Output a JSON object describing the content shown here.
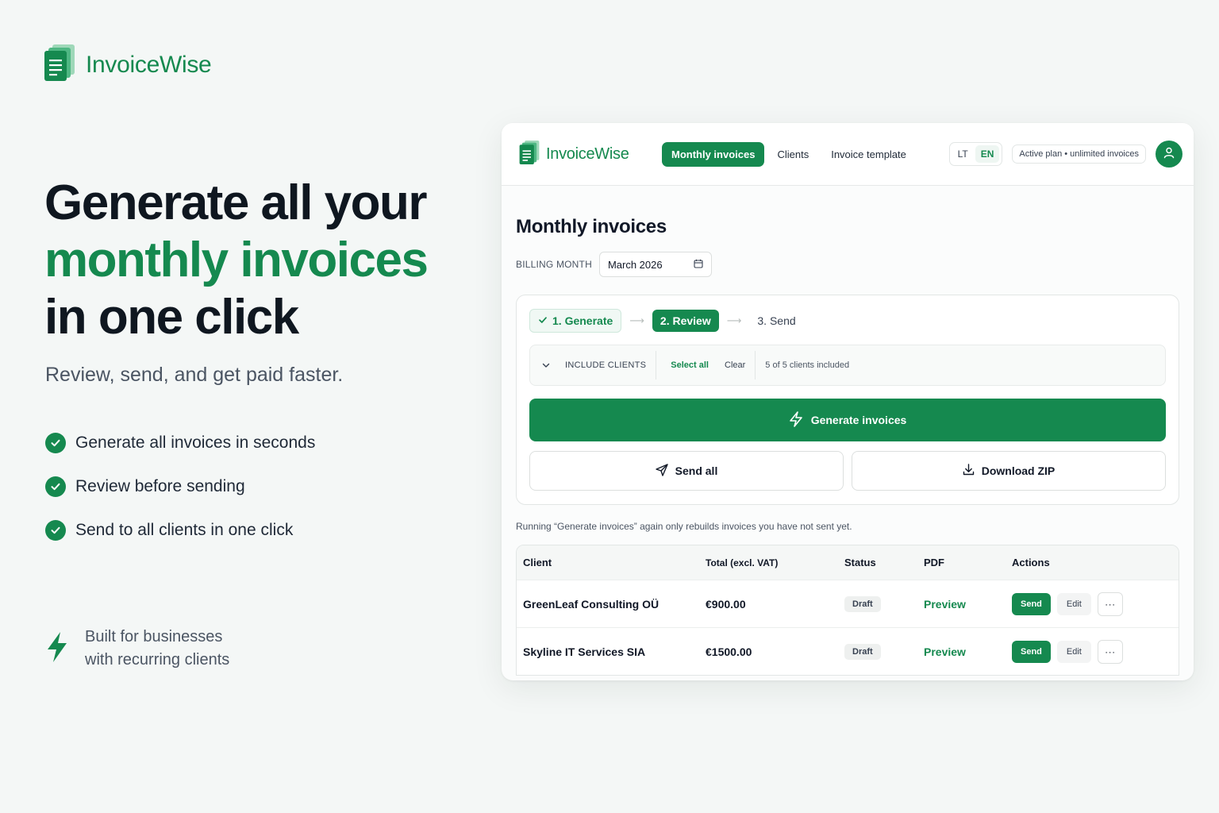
{
  "brand": {
    "name": "InvoiceWise"
  },
  "hero": {
    "title_line1": "Generate all your",
    "title_line2": "monthly invoices",
    "title_line3": "in one click",
    "subtitle": "Review, send, and get paid faster.",
    "features": [
      "Generate all invoices in seconds",
      "Review before sending",
      "Send to all clients in one click"
    ],
    "built_line1": "Built for businesses",
    "built_line2": "with recurring clients"
  },
  "app": {
    "brand": "InvoiceWise",
    "nav": [
      "Monthly invoices",
      "Clients",
      "Invoice template"
    ],
    "lang": [
      "LT",
      "EN"
    ],
    "plan": "Active plan • unlimited invoices",
    "page_title": "Monthly invoices",
    "billing_label": "BILLING MONTH",
    "billing_month": "March 2026",
    "steps": [
      "1. Generate",
      "2. Review",
      "3. Send"
    ],
    "include_label": "INCLUDE CLIENTS",
    "select_all": "Select all",
    "clear": "Clear",
    "included_text": "5 of 5 clients included",
    "generate_label": "Generate invoices",
    "send_all_label": "Send all",
    "download_label": "Download ZIP",
    "note": "Running “Generate invoices” again only rebuilds invoices you have not sent yet.",
    "table": {
      "headers": [
        "Client",
        "Total (excl. VAT)",
        "Status",
        "PDF",
        "Actions"
      ],
      "rows": [
        {
          "client": "GreenLeaf Consulting OÜ",
          "total": "€900.00",
          "status": "Draft",
          "pdf": "Preview",
          "send": "Send",
          "edit": "Edit",
          "more": "···"
        },
        {
          "client": "Skyline IT Services SIA",
          "total": "€1500.00",
          "status": "Draft",
          "pdf": "Preview",
          "send": "Send",
          "edit": "Edit",
          "more": "···"
        }
      ]
    }
  },
  "colors": {
    "accent": "#15894f",
    "background": "#f4f7f6",
    "text": "#0f1720"
  },
  "icons": [
    "document-stack-icon",
    "check-circle-icon",
    "lightning-bolt-icon",
    "calendar-icon",
    "check-icon",
    "chevron-down-icon",
    "send-icon",
    "download-icon",
    "user-icon",
    "more-icon"
  ]
}
